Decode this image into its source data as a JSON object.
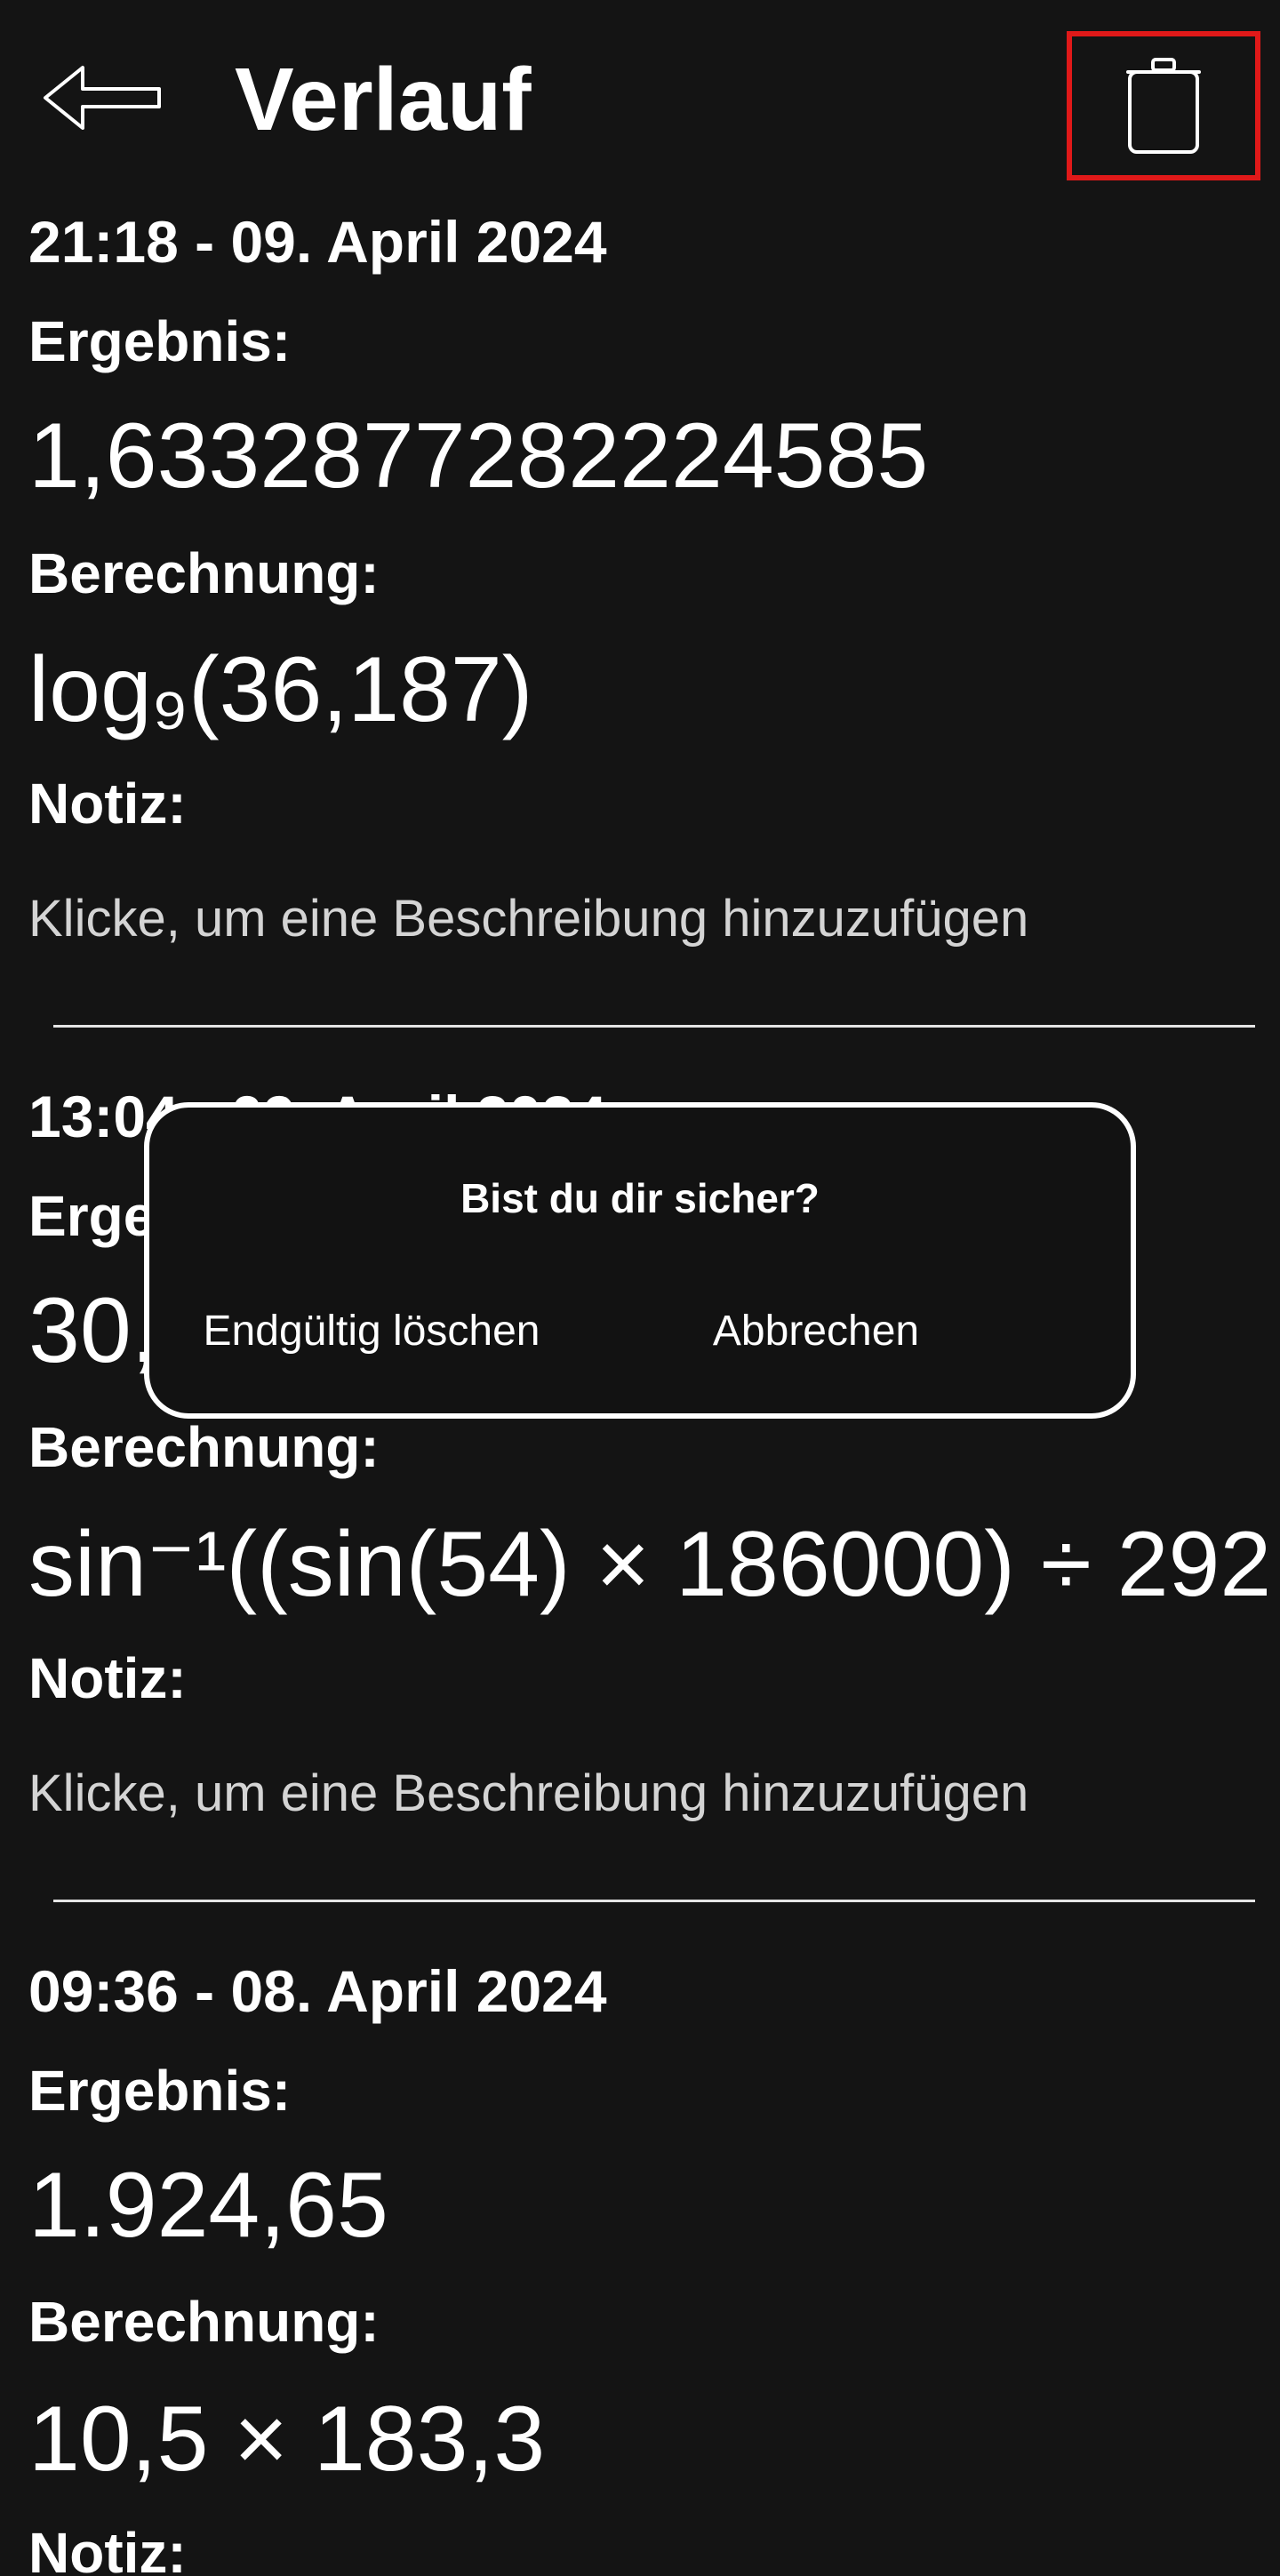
{
  "header": {
    "title": "Verlauf",
    "back_icon": "arrow-left-icon",
    "delete_all_icon": "trash-icon",
    "highlight_color": "#e01919"
  },
  "labels": {
    "result": "Ergebnis:",
    "calculation": "Berechnung:",
    "note": "Notiz:",
    "note_placeholder": "Klicke, um eine Beschreibung hinzuzufügen"
  },
  "entries": [
    {
      "timestamp": "21:18 - 09. April 2024",
      "result": "1,6332877282224585",
      "calculation": "log₉(36,187)"
    },
    {
      "timestamp": "13:04 - 09. April 2024",
      "result": "30,",
      "calculation": "sin⁻¹((sin(54) × 186000) ÷ 292"
    },
    {
      "timestamp": "09:36 - 08. April 2024",
      "result": "1.924,65",
      "calculation": "10,5 × 183,3"
    }
  ],
  "dialog": {
    "title": "Bist du dir sicher?",
    "confirm_label": "Endgültig löschen",
    "cancel_label": "Abbrechen"
  }
}
